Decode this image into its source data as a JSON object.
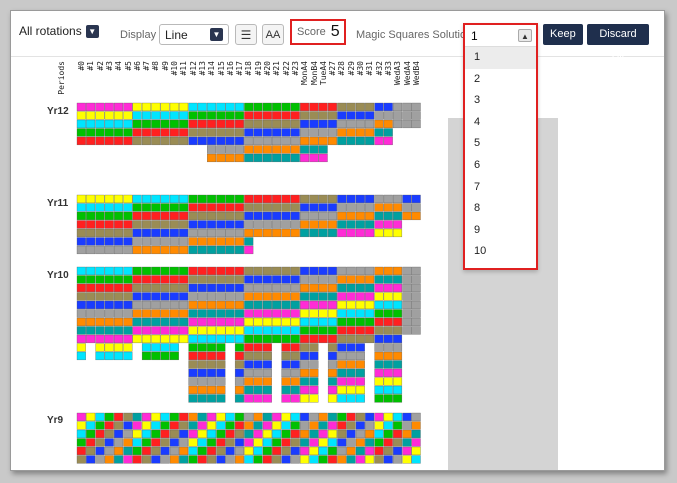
{
  "toolbar": {
    "rotations_value": "All rotations",
    "display_label": "Display",
    "display_value": "Line",
    "font_button": "AA",
    "score_label": "Score",
    "score_value": "5",
    "solution_label": "Magic Squares Solution",
    "solution_value": "1",
    "keep_button": "Keep",
    "discard_button": "Discard All"
  },
  "dropdown_options": [
    "1",
    "2",
    "3",
    "4",
    "5",
    "6",
    "7",
    "8",
    "9",
    "10"
  ],
  "periods_label": "Periods",
  "column_labels": [
    "#0",
    "#1",
    "#2",
    "#3",
    "#4",
    "#5",
    "#6",
    "#7",
    "#8",
    "#9",
    "#10",
    "#11",
    "#12",
    "#13",
    "#14",
    "#15",
    "#16",
    "#17",
    "#18",
    "#19",
    "#20",
    "#21",
    "#22",
    "#23",
    "MonA4",
    "MonB4",
    "TueA4",
    "#27",
    "#28",
    "#29",
    "#30",
    "#31",
    "#32",
    "#33",
    "WedA3",
    "WedA4",
    "WedB4"
  ],
  "year_labels": [
    "Yr12",
    "Yr11",
    "Yr10",
    "Yr9"
  ],
  "colors": {
    "dark": "#1f2f4d",
    "highlight": "#e02020",
    "panel": "#d4d4d4"
  }
}
